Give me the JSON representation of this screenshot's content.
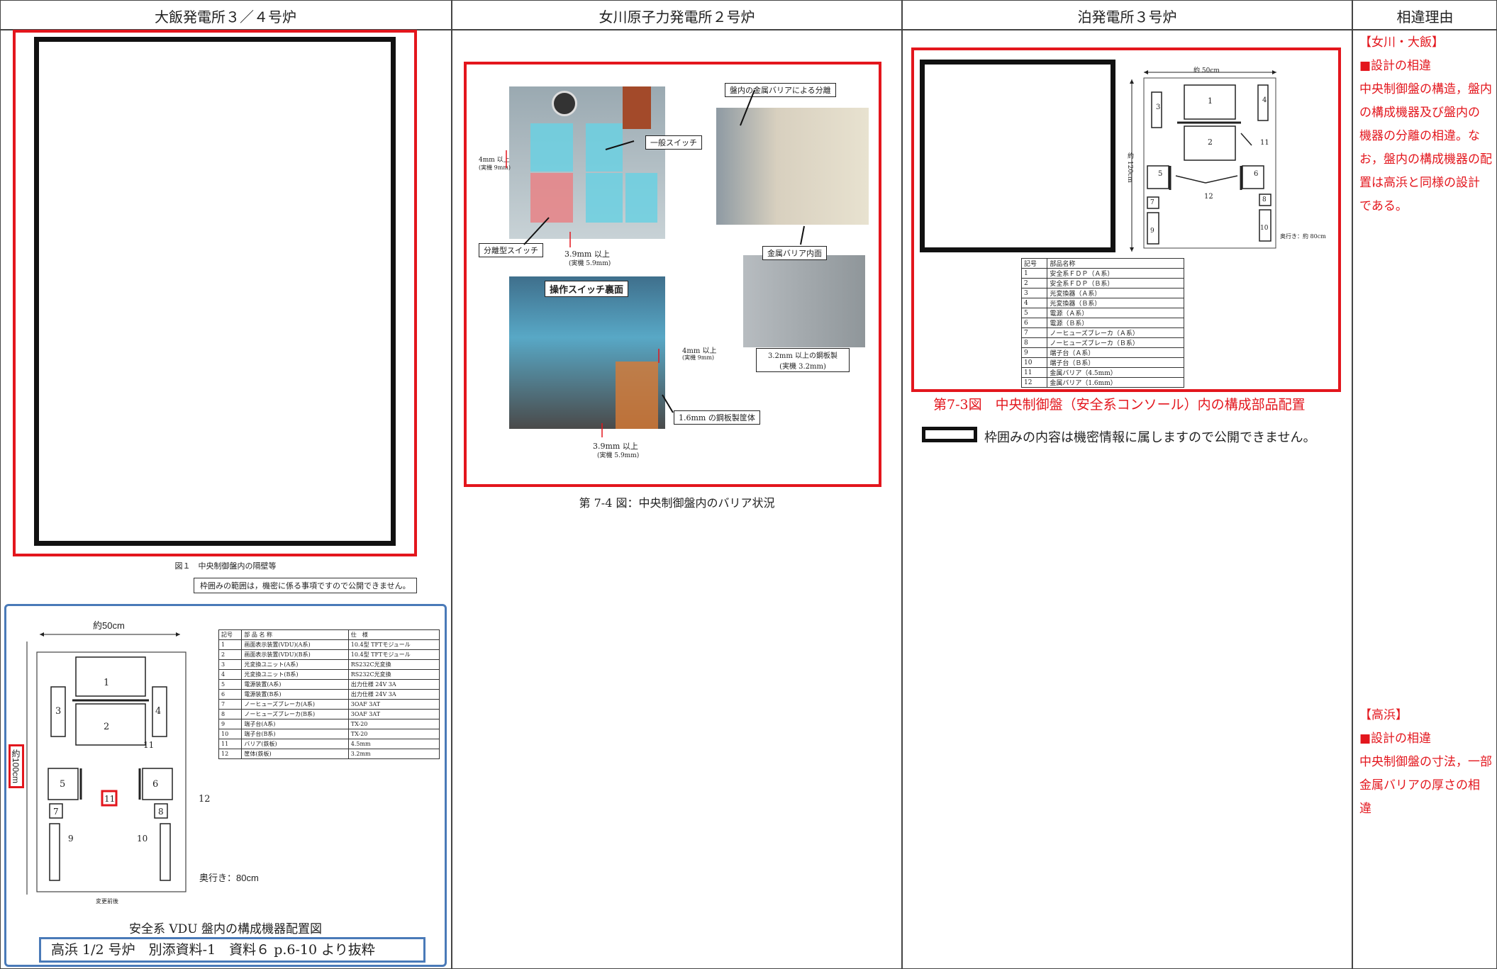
{
  "headers": {
    "col1": "大飯発電所３／４号炉",
    "col2": "女川原子力発電所２号炉",
    "col3": "泊発電所３号炉",
    "col4": "相違理由"
  },
  "ohi": {
    "fig1_caption": "図１　中央制御盤内の隔壁等",
    "confidential_note": "枠囲みの範囲は，機密に係る事項ですので公開できません。",
    "layout": {
      "width_label": "約50cm",
      "height_label": "約100cm",
      "depth_label": "奥行き：80cm",
      "bottom_label": "変更前後",
      "boxes": [
        "1",
        "2",
        "3",
        "4",
        "5",
        "6",
        "7",
        "8"
      ],
      "markers": [
        "9",
        "10",
        "11",
        "11",
        "12"
      ]
    },
    "parts_table": {
      "headers": [
        "記号",
        "部 品 名 称",
        "仕　様"
      ],
      "rows": [
        [
          "1",
          "画面表示装置(VDU)(A系)",
          "10.4型 TFTモジュール"
        ],
        [
          "2",
          "画面表示装置(VDU)(B系)",
          "10.4型 TFTモジュール"
        ],
        [
          "3",
          "光変換ユニット(A系)",
          "RS232C光変換"
        ],
        [
          "4",
          "光変換ユニット(B系)",
          "RS232C光変換"
        ],
        [
          "5",
          "電源装置(A系)",
          "出力仕様 24V 3A"
        ],
        [
          "6",
          "電源装置(B系)",
          "出力仕様 24V 3A"
        ],
        [
          "7",
          "ノーヒューズブレーカ(A系)",
          "3OAF 3AT"
        ],
        [
          "8",
          "ノーヒューズブレーカ(B系)",
          "3OAF 3AT"
        ],
        [
          "9",
          "端子台(A系)",
          "TX-20"
        ],
        [
          "10",
          "端子台(B系)",
          "TX-20"
        ],
        [
          "11",
          "バリア(鉄板)",
          "4.5mm"
        ],
        [
          "12",
          "筐体(鉄板)",
          "3.2mm"
        ]
      ]
    },
    "vdu_caption": "安全系 VDU 盤内の構成機器配置図",
    "source_note": "高浜 1/2 号炉　別添資料-1　資料６ p.6-10 より抜粋"
  },
  "onagawa": {
    "labels": {
      "metal_barrier": "盤内の金属バリアによる分離",
      "general_switch": "一般スイッチ",
      "separate_switch": "分離型スイッチ",
      "gap_4mm": "4mm 以上",
      "gap_4mm_actual": "(実機 9mm)",
      "gap_39": "3.9mm 以上",
      "gap_39_actual": "(実機 5.9mm)",
      "metal_inner": "金属バリア内面",
      "steel_32": "3.2mm 以上の鋼板製",
      "steel_32_actual": "(実機 3.2mm)",
      "back_side": "操作スイッチ裏面",
      "gap_4mm_b": "4mm 以上",
      "gap_4mm_b_actual": "(実機 9mm)",
      "steel_case": "1.6mm の鋼板製筐体",
      "gap_39_b": "3.9mm 以上",
      "gap_39_b_actual": "(実機 5.9mm)"
    },
    "caption": "第 7-4 図：中央制御盤内のバリア状況"
  },
  "tomari": {
    "width_label": "約 50cm",
    "height_label": "約 120cm",
    "depth_label": "奥行き：約 80cm",
    "boxes": [
      "1",
      "2",
      "3",
      "4",
      "5",
      "6",
      "7",
      "8",
      "9",
      "10"
    ],
    "markers": [
      "11",
      "12"
    ],
    "parts_table": {
      "headers": [
        "記号",
        "部品名称"
      ],
      "rows": [
        [
          "1",
          "安全系ＦＤＰ（Ａ系）"
        ],
        [
          "2",
          "安全系ＦＤＰ（Ｂ系）"
        ],
        [
          "3",
          "光変換器（Ａ系）"
        ],
        [
          "4",
          "光変換器（Ｂ系）"
        ],
        [
          "5",
          "電源（Ａ系）"
        ],
        [
          "6",
          "電源（Ｂ系）"
        ],
        [
          "7",
          "ノーヒューズブレーカ（Ａ系）"
        ],
        [
          "8",
          "ノーヒューズブレーカ（Ｂ系）"
        ],
        [
          "9",
          "端子台（Ａ系）"
        ],
        [
          "10",
          "端子台（Ｂ系）"
        ],
        [
          "11",
          "金属バリア（4.5mm）"
        ],
        [
          "12",
          "金属バリア（1.6mm）"
        ]
      ]
    },
    "caption": "第7-3図　中央制御盤（安全系コンソール）内の構成部品配置",
    "confidential_note": "枠囲みの内容は機密情報に属しますので公開できません。"
  },
  "reasons": {
    "block1_title": "【女川・大飯】",
    "block1_head": "■設計の相違",
    "block1_lines": [
      "中央制御盤の構造，盤内",
      "の構成機器及び盤内の",
      "機器の分離の相違。な",
      "お，盤内の構成機器の配",
      "置は高浜と同様の設計",
      "である。"
    ],
    "block2_title": "【高浜】",
    "block2_head": "■設計の相違",
    "block2_lines": [
      "中央制御盤の寸法，一部",
      "金属バリアの厚さの相",
      "違"
    ]
  },
  "colors": {
    "red": "#e3161d",
    "blue": "#4a7ab8",
    "black": "#111111"
  }
}
